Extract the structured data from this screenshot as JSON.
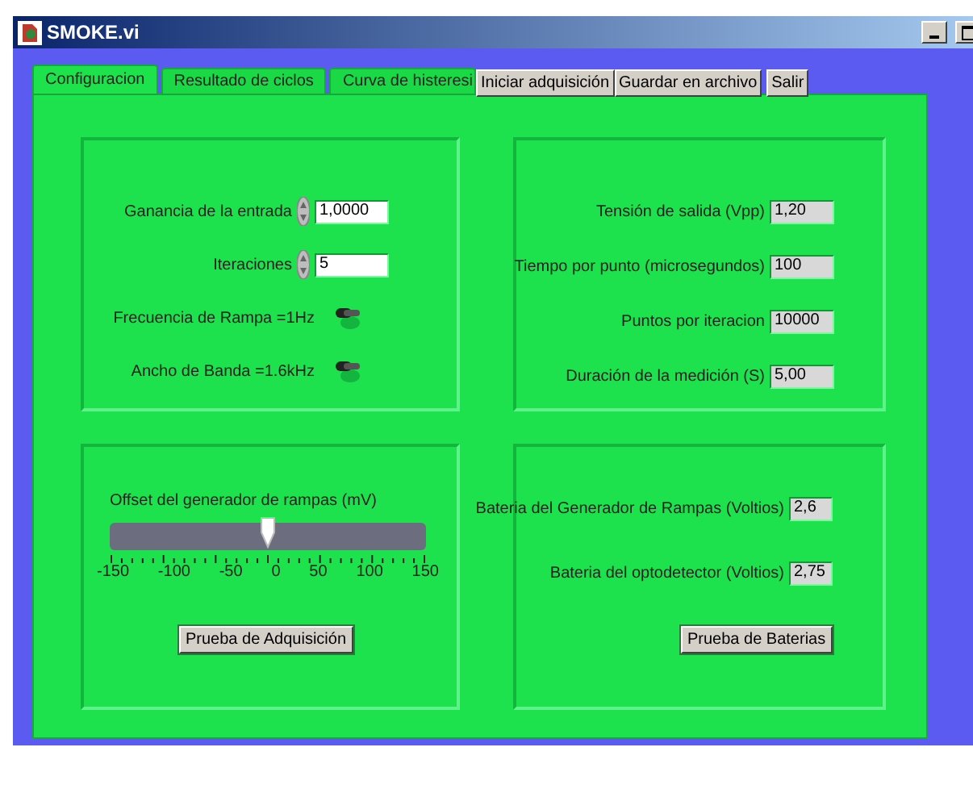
{
  "window": {
    "title": "SMOKE.vi"
  },
  "tabs": [
    {
      "label": "Configuracion",
      "selected": true
    },
    {
      "label": "Resultado de ciclos",
      "selected": false
    },
    {
      "label": "Curva de histeresi",
      "selected": false
    }
  ],
  "toolbar_buttons": [
    "Iniciar adquisición",
    "Guardar en archivo",
    "Salir"
  ],
  "settings": [
    {
      "kind": "numeric",
      "label": "Ganancia de la entrada",
      "value": "1,0000"
    },
    {
      "kind": "numeric",
      "label": "Iteraciones",
      "value": "5"
    },
    {
      "kind": "switch",
      "label": "Frecuencia de Rampa =1Hz",
      "on": false
    },
    {
      "kind": "switch",
      "label": "Ancho de Banda =1.6kHz",
      "on": false
    }
  ],
  "outputs": [
    {
      "label": "Tensión de salida (Vpp)",
      "value": "1,20"
    },
    {
      "label": "Tiempo por punto (microsegundos)",
      "value": "100"
    },
    {
      "label": "Puntos por iteracion",
      "value": "10000"
    },
    {
      "label": "Duración de la medición (S)",
      "value": "5,00"
    }
  ],
  "offset_slider": {
    "label": "Offset del generador de rampas (mV)",
    "level": 0.5,
    "scale": [
      "-150",
      "-100",
      "-50",
      "0",
      "50",
      "100",
      "150"
    ],
    "button": "Prueba de Adquisición"
  },
  "batteries": {
    "readings": [
      {
        "label": "Bateria del Generador de Rampas (Voltios)",
        "value": "2,6"
      },
      {
        "label": "Bateria del optodetector (Voltios)",
        "value": "2,75"
      }
    ],
    "button": "Prueba de Baterias"
  }
}
